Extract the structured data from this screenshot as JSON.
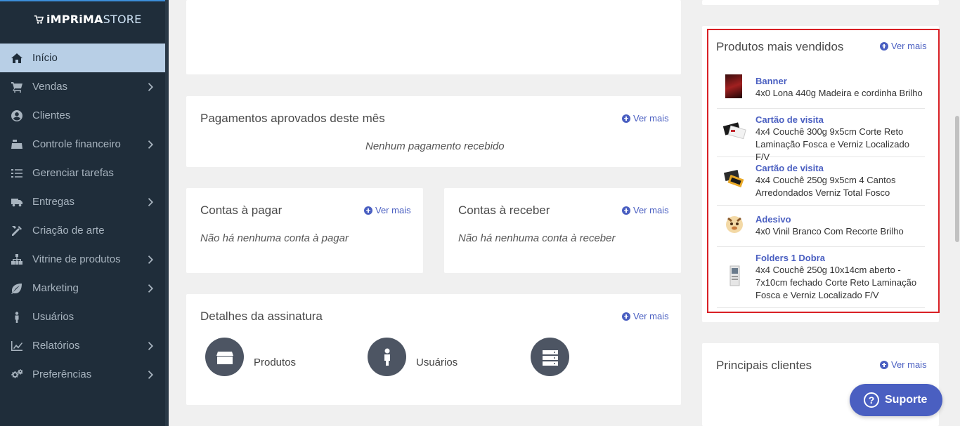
{
  "brand": {
    "logo_bold": "iMPRiMA",
    "logo_light": "STORE"
  },
  "sidebar": {
    "items": [
      {
        "label": "Início",
        "icon": "home-icon",
        "active": true,
        "has_submenu": false
      },
      {
        "label": "Vendas",
        "icon": "cart-icon",
        "active": false,
        "has_submenu": true
      },
      {
        "label": "Clientes",
        "icon": "user-circle-icon",
        "active": false,
        "has_submenu": false
      },
      {
        "label": "Controle financeiro",
        "icon": "cash-register-icon",
        "active": false,
        "has_submenu": true
      },
      {
        "label": "Gerenciar tarefas",
        "icon": "tasks-icon",
        "active": false,
        "has_submenu": false
      },
      {
        "label": "Entregas",
        "icon": "truck-icon",
        "active": false,
        "has_submenu": true
      },
      {
        "label": "Criação de arte",
        "icon": "tools-icon",
        "active": false,
        "has_submenu": false
      },
      {
        "label": "Vitrine de produtos",
        "icon": "sitemap-icon",
        "active": false,
        "has_submenu": true
      },
      {
        "label": "Marketing",
        "icon": "leaf-icon",
        "active": false,
        "has_submenu": true
      },
      {
        "label": "Usuários",
        "icon": "person-icon",
        "active": false,
        "has_submenu": false
      },
      {
        "label": "Relatórios",
        "icon": "chart-line-icon",
        "active": false,
        "has_submenu": true
      },
      {
        "label": "Preferências",
        "icon": "cogs-icon",
        "active": false,
        "has_submenu": true
      }
    ]
  },
  "common": {
    "ver_mais": "Ver mais"
  },
  "pagamentos": {
    "title": "Pagamentos aprovados deste mês",
    "empty": "Nenhum pagamento recebido"
  },
  "contas_pagar": {
    "title": "Contas à pagar",
    "empty": "Não há nenhuma conta à pagar"
  },
  "contas_receber": {
    "title": "Contas à receber",
    "empty": "Não há nenhuma conta à receber"
  },
  "assinatura": {
    "title": "Detalhes da assinatura",
    "items": [
      {
        "label": "Produtos",
        "icon": "box-icon"
      },
      {
        "label": "Usuários",
        "icon": "person-icon"
      },
      {
        "label": "",
        "icon": "server-icon"
      }
    ]
  },
  "produtos": {
    "title": "Produtos mais vendidos",
    "items": [
      {
        "name": "Banner",
        "desc": "4x0 Lona 440g Madeira e cordinha Brilho"
      },
      {
        "name": "Cartão de visita",
        "desc": "4x4 Couchê 300g 9x5cm Corte Reto Laminação Fosca e Verniz Localizado F/V"
      },
      {
        "name": "Cartão de visita",
        "desc": "4x4 Couchê 250g 9x5cm 4 Cantos Arredondados Verniz Total Fosco"
      },
      {
        "name": "Adesivo",
        "desc": "4x0 Vinil Branco Com Recorte Brilho"
      },
      {
        "name": "Folders 1 Dobra",
        "desc": "4x4 Couchê 250g 10x14cm aberto - 7x10cm fechado Corte Reto Laminação Fosca e Verniz Localizado F/V"
      }
    ]
  },
  "clientes": {
    "title": "Principais clientes"
  },
  "support": {
    "label": "Suporte"
  },
  "colors": {
    "sidebar_bg": "#1f2d3a",
    "active_bg": "#b8cfe6",
    "accent": "#4a5fc1",
    "highlight_border": "#d92025"
  }
}
